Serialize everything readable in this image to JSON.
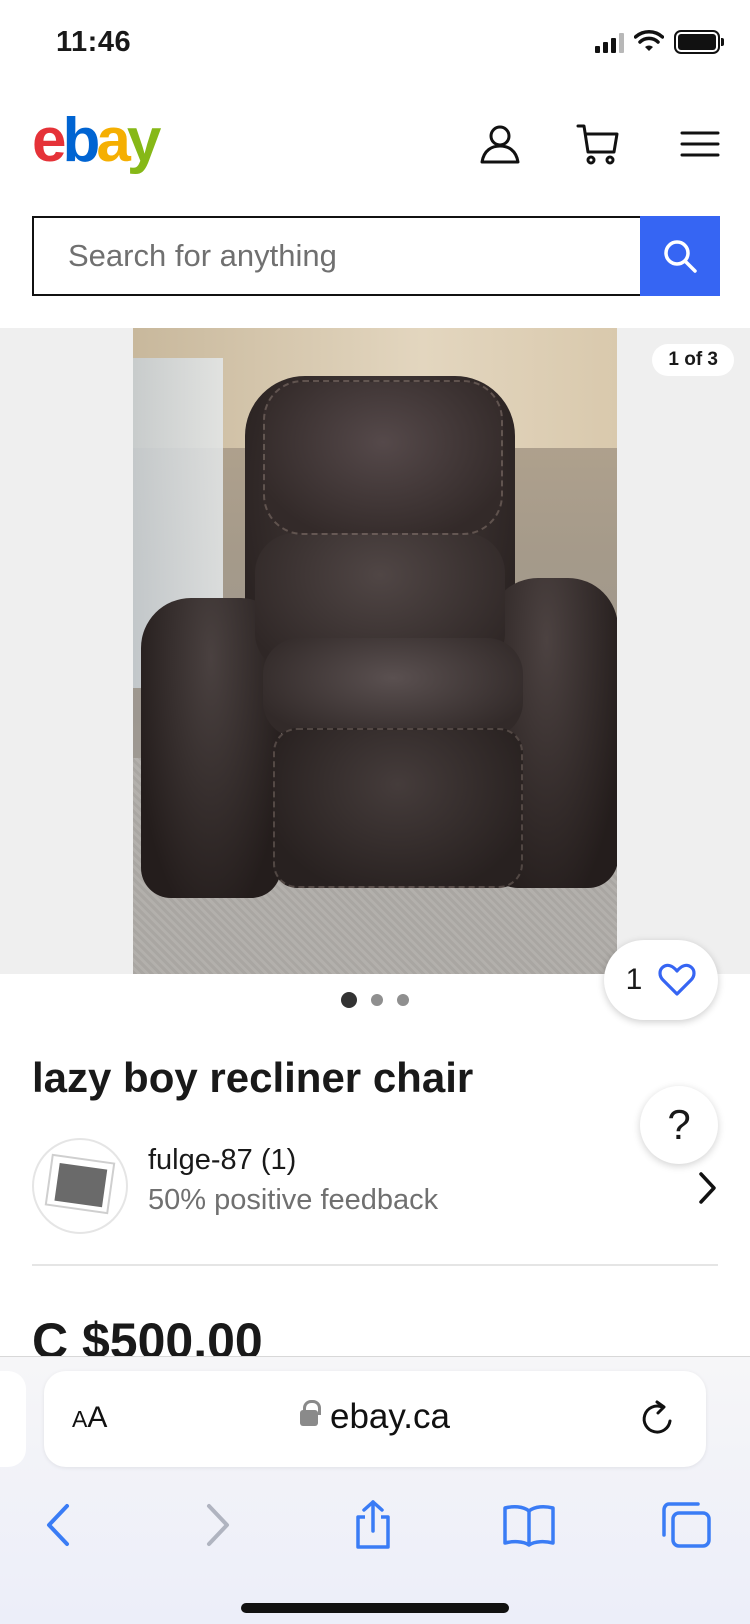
{
  "status_bar": {
    "time": "11:46"
  },
  "header": {
    "logo": {
      "e": "e",
      "b": "b",
      "a": "a",
      "y": "y"
    }
  },
  "search": {
    "placeholder": "Search for anything"
  },
  "gallery": {
    "counter": "1 of 3",
    "total_images": 3,
    "active_index": 1,
    "watch_count": "1"
  },
  "listing": {
    "title": "lazy boy recliner chair",
    "seller_name": "fulge-87 (1)",
    "seller_feedback": "50% positive feedback",
    "price": "C $500.00",
    "help_label": "?"
  },
  "browser": {
    "aa_label_small": "A",
    "aa_label_big": "A",
    "url": "ebay.ca"
  },
  "colors": {
    "ebay_red": "#e53238",
    "ebay_blue": "#0064d2",
    "ebay_yellow": "#f5af02",
    "ebay_green": "#86b817",
    "search_button": "#3665f3",
    "safari_blue": "#3a7cf5"
  }
}
